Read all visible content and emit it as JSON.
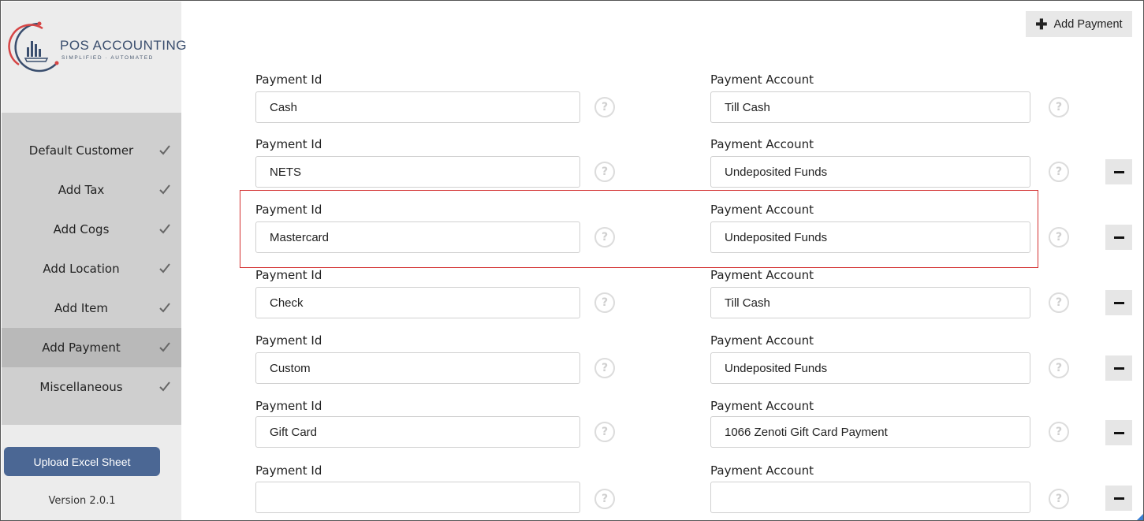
{
  "logo": {
    "title": "POS ACCOUNTING",
    "subtitle": "SIMPLIFIED · AUTOMATED"
  },
  "sidebar": {
    "items": [
      {
        "label": "Default Customer",
        "done": true,
        "active": false
      },
      {
        "label": "Add Tax",
        "done": true,
        "active": false
      },
      {
        "label": "Add Cogs",
        "done": true,
        "active": false
      },
      {
        "label": "Add Location",
        "done": true,
        "active": false
      },
      {
        "label": "Add Item",
        "done": true,
        "active": false
      },
      {
        "label": "Add Payment",
        "done": true,
        "active": true
      },
      {
        "label": "Miscellaneous",
        "done": true,
        "active": false
      }
    ],
    "upload_label": "Upload Excel Sheet",
    "version": "Version 2.0.1"
  },
  "toolbar": {
    "add_payment_label": "Add Payment",
    "add_icon": "plus-icon"
  },
  "payments": {
    "id_label": "Payment Id",
    "account_label": "Payment Account",
    "help_glyph": "?",
    "rows": [
      {
        "id": "Cash",
        "account": "Till Cash",
        "removable": false
      },
      {
        "id": "NETS",
        "account": "Undeposited Funds",
        "removable": true
      },
      {
        "id": "Mastercard",
        "account": "Undeposited Funds",
        "removable": true,
        "highlighted": true
      },
      {
        "id": "Check",
        "account": "Till Cash",
        "removable": true
      },
      {
        "id": "Custom",
        "account": "Undeposited Funds",
        "removable": true
      },
      {
        "id": "Gift Card",
        "account": "1066 Zenoti Gift Card Payment",
        "removable": true
      },
      {
        "id": "",
        "account": "",
        "removable": true
      }
    ]
  },
  "colors": {
    "accent": "#4b6794",
    "highlight": "#d32f2f",
    "sidebar_bg": "#ececec",
    "nav_bg": "#cfcfcf",
    "nav_active_bg": "#b9b9b9"
  }
}
